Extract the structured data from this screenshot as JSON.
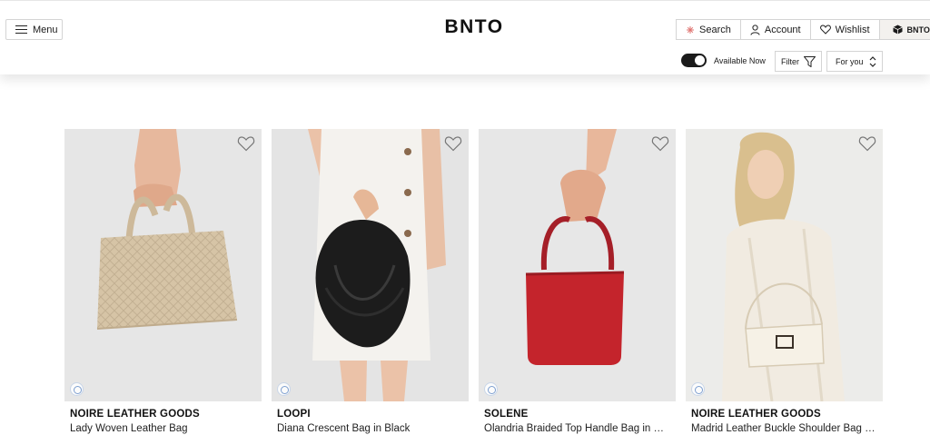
{
  "header": {
    "menu_label": "Menu",
    "logo": "BNTO",
    "nav": {
      "search_label": "Search",
      "account_label": "Account",
      "wishlist_label": "Wishlist",
      "cart_logo": "BNTO"
    },
    "available_now_label": "Available Now",
    "available_now_on": true,
    "filter_label": "Filter",
    "sort_label": "For you"
  },
  "icons": [
    "menu-icon",
    "search-icon",
    "account-icon",
    "heart-icon",
    "box-icon",
    "filter-icon",
    "updown-chevron-icon",
    "view-360-icon"
  ],
  "colors": {
    "accent": "#1a1a1a",
    "photo_bg": "#e9e9e9",
    "toggle_on": "#1a1a1a"
  },
  "products": [
    {
      "brand": "NOIRE LEATHER GOODS",
      "name": "Lady Woven Leather Bag"
    },
    {
      "brand": "LOOPI",
      "name": "Diana Crescent Bag in Black"
    },
    {
      "brand": "SOLENE",
      "name": "Olandria Braided Top Handle Bag in Red"
    },
    {
      "brand": "NOIRE LEATHER GOODS",
      "name": "Madrid Leather Buckle Shoulder Bag in..."
    }
  ]
}
